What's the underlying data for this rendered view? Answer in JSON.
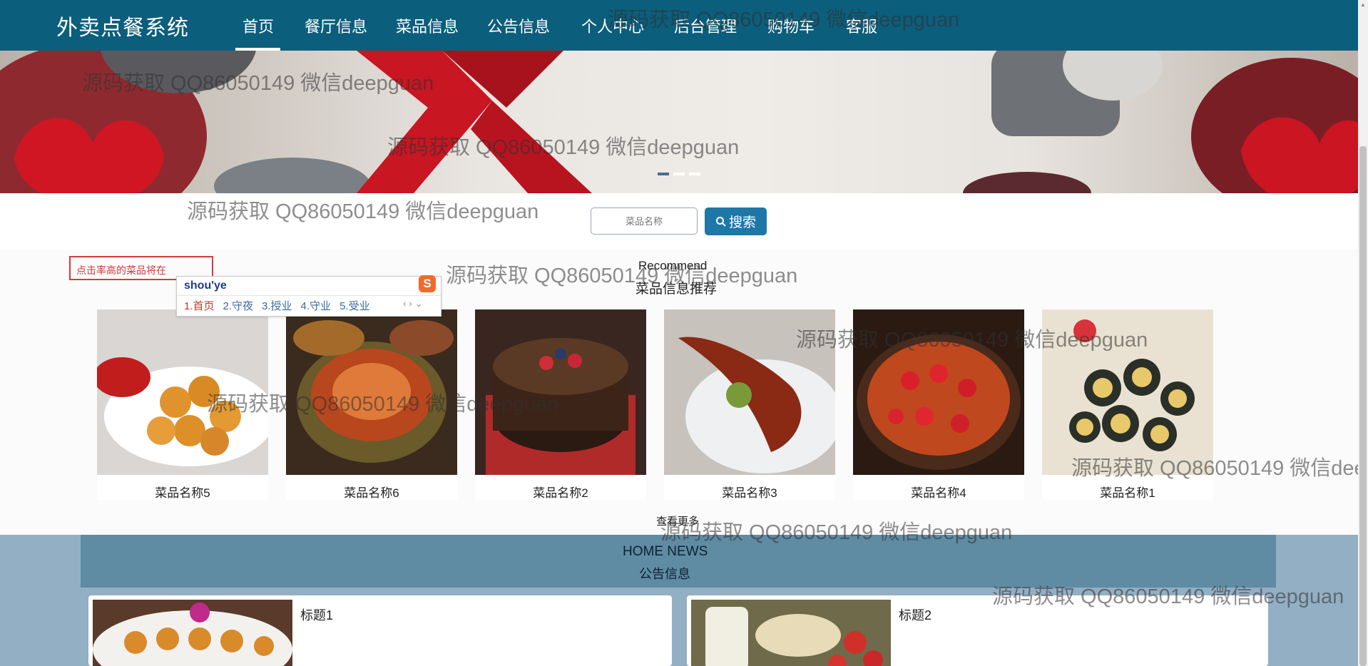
{
  "header": {
    "brand": "外卖点餐系统",
    "nav": [
      "首页",
      "餐厅信息",
      "菜品信息",
      "公告信息",
      "个人中心",
      "后台管理",
      "购物车",
      "客服"
    ]
  },
  "search": {
    "placeholder": "菜品名称",
    "button_label": "搜索",
    "button_icon": "search-icon"
  },
  "recommend": {
    "title_en": "Recommend",
    "title_cn": "菜品信息推荐",
    "notice": "点击率高的菜品将在",
    "products": [
      {
        "name": "菜品名称5"
      },
      {
        "name": "菜品名称6"
      },
      {
        "name": "菜品名称2"
      },
      {
        "name": "菜品名称3"
      },
      {
        "name": "菜品名称4"
      },
      {
        "name": "菜品名称1"
      }
    ],
    "view_more": "查看更多"
  },
  "ime": {
    "input": "shou'ye",
    "candidates": [
      "1.首页",
      "2.守夜",
      "3.授业",
      "4.守业",
      "5.受业"
    ],
    "logo": "S"
  },
  "news": {
    "title_en": "HOME NEWS",
    "title_cn": "公告信息",
    "items": [
      {
        "title": "标题1"
      },
      {
        "title": "标题2"
      }
    ]
  },
  "watermark": "源码获取 QQ86050149 微信deepguan",
  "colors": {
    "header_bg": "#0b5e7c",
    "search_button": "#1d78a8",
    "news_bg": "#93afc3",
    "news_header": "#5f8ba3"
  }
}
